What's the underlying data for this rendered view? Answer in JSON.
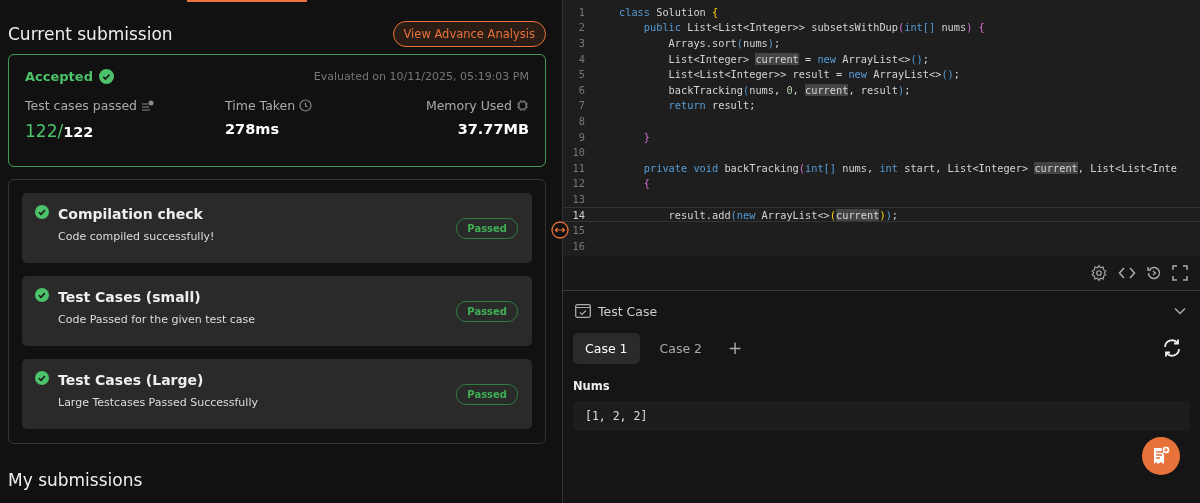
{
  "submission": {
    "title": "Current submission",
    "analysis_button": "View Advance Analysis",
    "status": "Accepted",
    "evaluated": "Evaluated on 10/11/2025, 05:19:03 PM",
    "stats": [
      {
        "kind": "tests",
        "label": "Test cases passed",
        "passed": "122/",
        "total": "122"
      },
      {
        "kind": "time",
        "label": "Time Taken",
        "value": "278ms"
      },
      {
        "kind": "memory",
        "label": "Memory Used",
        "value": "37.77MB"
      }
    ]
  },
  "checks": [
    {
      "title": "Compilation check",
      "detail": "Code compiled successfully!",
      "badge": "Passed"
    },
    {
      "title": "Test Cases (small)",
      "detail": "Code Passed for the given test case",
      "badge": "Passed"
    },
    {
      "title": "Test Cases (Large)",
      "detail": "Large Testcases Passed Successfully",
      "badge": "Passed"
    }
  ],
  "my_submissions": "My submissions",
  "editor": {
    "lines": [
      {
        "number": "1",
        "tokens": [
          {
            "text": "class",
            "kind": "kw"
          },
          {
            "text": " Solution ",
            "kind": "plain"
          },
          {
            "text": "{",
            "kind": "brace"
          }
        ]
      },
      {
        "number": "2",
        "tokens": [
          {
            "text": "    public",
            "kind": "kw"
          },
          {
            "text": " List<List<Integer>> subsetsWithDup",
            "kind": "plain"
          },
          {
            "text": "(",
            "kind": "brace2"
          },
          {
            "text": "int",
            "kind": "kw"
          },
          {
            "text": "[]",
            "kind": "kw"
          },
          {
            "text": " nums",
            "kind": "plain"
          },
          {
            "text": ")",
            "kind": "brace2"
          },
          {
            "text": " {",
            "kind": "brace2"
          }
        ]
      },
      {
        "number": "3",
        "tokens": [
          {
            "text": "        Arrays.sort",
            "kind": "plain"
          },
          {
            "text": "(",
            "kind": "kw"
          },
          {
            "text": "nums",
            "kind": "plain"
          },
          {
            "text": ")",
            "kind": "kw"
          },
          {
            "text": ";",
            "kind": "plain"
          }
        ]
      },
      {
        "number": "4",
        "tokens": [
          {
            "text": "        List<Integer> ",
            "kind": "plain"
          },
          {
            "text": "current",
            "kind": "hl"
          },
          {
            "text": " = ",
            "kind": "plain"
          },
          {
            "text": "new",
            "kind": "kw"
          },
          {
            "text": " ArrayList<>",
            "kind": "plain"
          },
          {
            "text": "()",
            "kind": "kw"
          },
          {
            "text": ";",
            "kind": "plain"
          }
        ]
      },
      {
        "number": "5",
        "tokens": [
          {
            "text": "        List<List<Integer>> result = ",
            "kind": "plain"
          },
          {
            "text": "new",
            "kind": "kw"
          },
          {
            "text": " ArrayList<>",
            "kind": "plain"
          },
          {
            "text": "()",
            "kind": "kw"
          },
          {
            "text": ";",
            "kind": "plain"
          }
        ]
      },
      {
        "number": "6",
        "tokens": [
          {
            "text": "        backTracking",
            "kind": "plain"
          },
          {
            "text": "(",
            "kind": "kw"
          },
          {
            "text": "nums, ",
            "kind": "plain"
          },
          {
            "text": "0",
            "kind": "num"
          },
          {
            "text": ", ",
            "kind": "plain"
          },
          {
            "text": "current",
            "kind": "hl"
          },
          {
            "text": ", result",
            "kind": "plain"
          },
          {
            "text": ")",
            "kind": "kw"
          },
          {
            "text": ";",
            "kind": "plain"
          }
        ]
      },
      {
        "number": "7",
        "tokens": [
          {
            "text": "        return",
            "kind": "kw"
          },
          {
            "text": " result;",
            "kind": "plain"
          }
        ]
      },
      {
        "number": "8"
      },
      {
        "number": "9",
        "tokens": [
          {
            "text": "    }",
            "kind": "brace2"
          }
        ]
      },
      {
        "number": "10"
      },
      {
        "number": "11",
        "tokens": [
          {
            "text": "    private void",
            "kind": "kw"
          },
          {
            "text": " backTracking",
            "kind": "plain"
          },
          {
            "text": "(",
            "kind": "brace2"
          },
          {
            "text": "int[]",
            "kind": "kw"
          },
          {
            "text": " nums, ",
            "kind": "plain"
          },
          {
            "text": "int",
            "kind": "kw"
          },
          {
            "text": " start, List<Integer> ",
            "kind": "plain"
          },
          {
            "text": "current",
            "kind": "hl"
          },
          {
            "text": ", List<List<Inte",
            "kind": "plain"
          }
        ]
      },
      {
        "number": "12",
        "tokens": [
          {
            "text": "    {",
            "kind": "brace2"
          }
        ]
      },
      {
        "number": "13"
      },
      {
        "number": "14",
        "current": true,
        "tokens": [
          {
            "text": "        result.add",
            "kind": "plain"
          },
          {
            "text": "(",
            "kind": "kw"
          },
          {
            "text": "new",
            "kind": "kw"
          },
          {
            "text": " ArrayList<>",
            "kind": "plain"
          },
          {
            "text": "(",
            "kind": "brace"
          },
          {
            "text": "current",
            "kind": "hl"
          },
          {
            "text": ")",
            "kind": "brace"
          },
          {
            "text": ")",
            "kind": "kw"
          },
          {
            "text": ";",
            "kind": "plain"
          }
        ]
      },
      {
        "number": "15"
      },
      {
        "number": "16"
      }
    ]
  },
  "testcase": {
    "title": "Test Case",
    "tabs": [
      {
        "label": "Case 1",
        "selected": true
      },
      {
        "label": "Case 2",
        "selected": false
      },
      {
        "label": "+",
        "selected": false
      }
    ],
    "param_label": "Nums",
    "param_value": "[1, 2, 2]"
  }
}
